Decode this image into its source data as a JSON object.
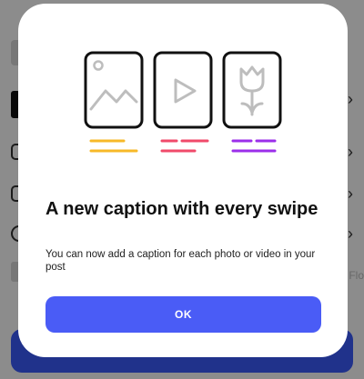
{
  "dialog": {
    "headline": "A new caption with every swipe",
    "body": "You can now add a caption for each photo or video in your post",
    "ok_label": "OK"
  },
  "background": {
    "side_text": "Flo"
  },
  "illustration": {
    "cards": [
      "image-icon",
      "play-icon",
      "flower-icon"
    ],
    "caption_line_colors": [
      "#f7b928",
      "#f04a6a",
      "#9b2fea"
    ]
  },
  "colors": {
    "primary_button": "#4a5cf6"
  }
}
